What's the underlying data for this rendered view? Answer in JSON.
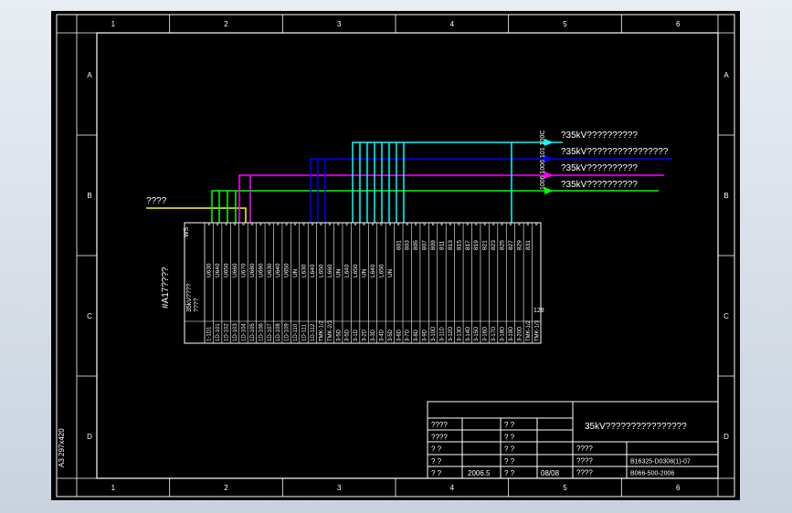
{
  "border": {
    "columns": [
      "1",
      "2",
      "3",
      "4",
      "5",
      "6"
    ],
    "rows": [
      "A",
      "B",
      "C",
      "D"
    ],
    "sheet_format": "A3 297x420"
  },
  "signals": {
    "left_label": "????",
    "outputs": [
      {
        "label": "?35kV??????????",
        "color": "#00ffff"
      },
      {
        "label": "?35kV????????????????",
        "color": "#0000ff"
      },
      {
        "label": "?35kV??????????",
        "color": "#ff00ff"
      },
      {
        "label": "?35kV??????????",
        "color": "#00ff00"
      }
    ],
    "vertical_code": "1006 1006 101 100C"
  },
  "terminal": {
    "block_title": "#A17????",
    "top_label": "WS",
    "device_labels": [
      "35kV????",
      "????"
    ],
    "wire_numbers": [
      "U630",
      "U640",
      "U650",
      "U660",
      "U670",
      "U680",
      "U690",
      "U630",
      "U640",
      "U650",
      "UN",
      "L630",
      "L640",
      "L650",
      "L660",
      "UN",
      "L640",
      "L650",
      "UN",
      "L640",
      "L650",
      "UN"
    ],
    "cell_codes": [
      "1-1D1",
      "1D-101",
      "1D-102",
      "1D-103",
      "1D-104",
      "1D-105",
      "1D-106",
      "1D-107",
      "1D-108",
      "1D-109",
      "1D-110",
      "1D-111",
      "1D-112",
      "TMK-1/2",
      "TMK-2/3",
      "3-5D",
      "3-5D",
      "3-1D",
      "3-2D",
      "3-3D",
      "3-4D",
      "3-5D",
      "3-6D",
      "3-7D",
      "3-8D",
      "3-9D",
      "3-10D",
      "3-11D",
      "3-12D",
      "3-13D",
      "3-14D",
      "3-15D",
      "3-16D",
      "3-17D",
      "3-18D",
      "3-19D",
      "3-20D",
      "TMK-1/2",
      "TMK-1/3"
    ],
    "right_numbers": [
      "801",
      "803",
      "805",
      "807",
      "809",
      "811",
      "813",
      "815",
      "817",
      "819",
      "821",
      "823",
      "825",
      "827",
      "829",
      "831"
    ],
    "end_label": "128"
  },
  "title_block": {
    "drawing_title": "35kV????????????????",
    "left_rows": [
      {
        "k": "????",
        "v": "",
        "k2": "?  ?",
        "v2": ""
      },
      {
        "k": "????",
        "v": "",
        "k2": "?  ?",
        "v2": ""
      },
      {
        "k": "?  ?",
        "v": "",
        "k2": "?  ?",
        "v2": ""
      },
      {
        "k": "?  ?",
        "v": "",
        "k2": "?  ?",
        "v2": ""
      },
      {
        "k": "?  ?",
        "v": "2006.5",
        "k2": "?  ?",
        "v2": "08/08"
      }
    ],
    "right_rows": [
      {
        "k": "????",
        "v": ""
      },
      {
        "k": "????",
        "v": "B16325-D0308(1)-07"
      },
      {
        "k": "????",
        "v": "B066-500-2006"
      }
    ]
  },
  "colors": {
    "background": "#000000",
    "line": "#ffffff",
    "yellow": "#ffff00",
    "cyan": "#00ffff",
    "blue": "#0000ff",
    "magenta": "#ff00ff",
    "green": "#00ff00"
  }
}
